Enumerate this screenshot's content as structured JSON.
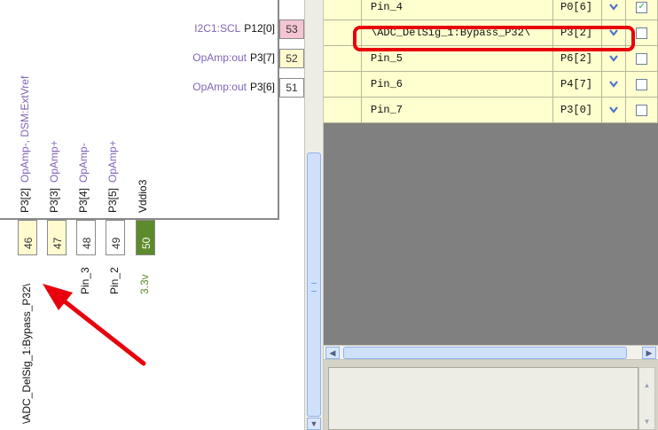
{
  "right_pins": [
    {
      "function": "I2C1:SCL",
      "port": "P12[0]",
      "number": "53",
      "color": "#f4c5d2"
    },
    {
      "function": "OpAmp:out",
      "port": "P3[7]",
      "number": "52",
      "color": "#fffbcf"
    },
    {
      "function": "OpAmp:out",
      "port": "P3[6]",
      "number": "51",
      "color": "#ffffff"
    }
  ],
  "bottom_pins": [
    {
      "port": "P3[2]",
      "function": "OpAmp-, DSM:ExtVref",
      "number": "46",
      "color": "#fffbcf",
      "label": "\\ADC_DelSig_1:Bypass_P32\\"
    },
    {
      "port": "P3[3]",
      "function": "OpAmp+",
      "number": "47",
      "color": "#fffbcf",
      "label": ""
    },
    {
      "port": "P3[4]",
      "function": "OpAmp-",
      "number": "48",
      "color": "#ffffff",
      "label": "Pin_3"
    },
    {
      "port": "P3[5]",
      "function": "OpAmp+",
      "number": "49",
      "color": "#ffffff",
      "label": "Pin_2"
    },
    {
      "port": "Vddio3",
      "function": "",
      "number": "50",
      "color": "#5d8a2a",
      "label": "3.3v"
    }
  ],
  "table_rows": [
    {
      "name": "Pin_4",
      "port": "P0[6]",
      "checked": true,
      "check_mark": "✓"
    },
    {
      "name": "\\ADC_DelSig_1:Bypass_P32\\",
      "port": "P3[2]",
      "checked": false,
      "check_mark": ""
    },
    {
      "name": "Pin_5",
      "port": "P6[2]",
      "checked": false,
      "check_mark": ""
    },
    {
      "name": "Pin_6",
      "port": "P4[7]",
      "checked": false,
      "check_mark": ""
    },
    {
      "name": "Pin_7",
      "port": "P3[0]",
      "checked": false,
      "check_mark": ""
    }
  ],
  "icons": {
    "dropdown": "chevron-down-icon",
    "scroll_left": "◀",
    "scroll_right": "▶",
    "scroll_up": "▲",
    "scroll_down": "▼"
  },
  "colors": {
    "highlight": "#e8000c",
    "arrow": "#e8000c",
    "function_text": "#8064b8",
    "power_text": "#5d8a2a",
    "table_row": "#ffffcf"
  }
}
